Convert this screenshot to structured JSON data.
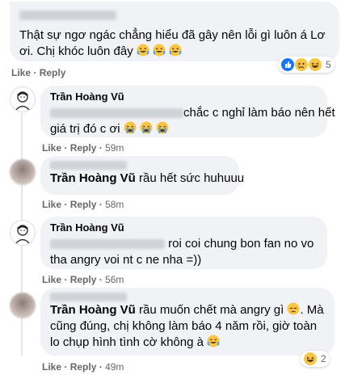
{
  "comments": [
    {
      "text_line1": "Thật sự ngơ ngác chẳng hiểu đã gây nên lỗi gì luôn á Lơ",
      "text_line2": "ơi. Chị khóc luôn đây",
      "emojis": [
        "laugh-cry-emoji",
        "laugh-cry-emoji",
        "laugh-cry-emoji"
      ],
      "actions": {
        "like": "Like",
        "reply": "Reply"
      },
      "time": "",
      "reactions": {
        "icons": [
          "like-reaction",
          "sad-reaction",
          "haha-reaction"
        ],
        "count": "5"
      }
    },
    {
      "author": "Trần Hoàng Vũ",
      "text_line1": "chắc c nghỉ làm báo nên hết",
      "text_line2": "giá trị đó c ơi",
      "emojis": [
        "crying-emoji",
        "crying-emoji",
        "crying-emoji"
      ],
      "actions": {
        "like": "Like",
        "reply": "Reply"
      },
      "time": "59m"
    },
    {
      "mention": "Trần Hoàng Vũ",
      "text_line1": "rầu hết sức huhuuu",
      "actions": {
        "like": "Like",
        "reply": "Reply"
      },
      "time": "58m"
    },
    {
      "author": "Trần Hoàng Vũ",
      "text_line1": "roi coi chung bon fan no vo",
      "text_line2": "tha angry voi nt c ne nha =))",
      "actions": {
        "like": "Like",
        "reply": "Reply"
      },
      "time": "56m"
    },
    {
      "mention": "Trần Hoàng Vũ",
      "text_line1": "rầu muốn chết mà angry gì",
      "text_line1_end": ". Mà",
      "text_line2": "cũng đúng, chị không làm báo 4 năm rồi, giờ toàn",
      "text_line3": "lo chụp hình tình cờ không à",
      "actions": {
        "like": "Like",
        "reply": "Reply"
      },
      "time": "49m",
      "reactions": {
        "icons": [
          "haha-reaction"
        ],
        "count": "2"
      }
    }
  ],
  "separator": "·",
  "colors": {
    "bubble": "#f0f2f5",
    "meta": "#65676b",
    "link": "#050505"
  }
}
